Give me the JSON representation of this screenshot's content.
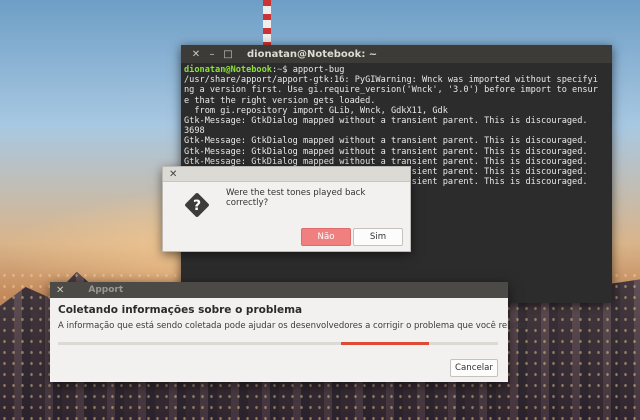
{
  "terminal": {
    "title": "dionatan@Notebook: ~",
    "prompt_user": "dionatan@Notebook",
    "prompt_path": "~",
    "prompt_cmd": "$ apport-bug",
    "lines": [
      "/usr/share/apport/apport-gtk:16: PyGIWarning: Wnck was imported without specifyi",
      "ng a version first. Use gi.require_version('Wnck', '3.0') before import to ensur",
      "e that the right version gets loaded.",
      "  from gi.repository import GLib, Wnck, GdkX11, Gdk",
      "Gtk-Message: GtkDialog mapped without a transient parent. This is discouraged.",
      "3698",
      "Gtk-Message: GtkDialog mapped without a transient parent. This is discouraged.",
      "Gtk-Message: GtkDialog mapped without a transient parent. This is discouraged.",
      "Gtk-Message: GtkDialog mapped without a transient parent. This is discouraged.",
      "Gtk-Message: GtkDialog mapped without a transient parent. This is discouraged.",
      "Gtk-Message: GtkDialog mapped without a transient parent. This is discouraged."
    ]
  },
  "question_dialog": {
    "question": "Were the test tones played back correctly?",
    "no_label": "Não",
    "yes_label": "Sim",
    "icon": "question-icon"
  },
  "apport": {
    "title": "Apport",
    "heading": "Coletando informações sobre o problema",
    "description": "A informação que está sendo coletada pode ajudar os desenvolvedores a corrigir o problema que você relatou.",
    "cancel_label": "Cancelar",
    "accent": "#df4a35"
  }
}
